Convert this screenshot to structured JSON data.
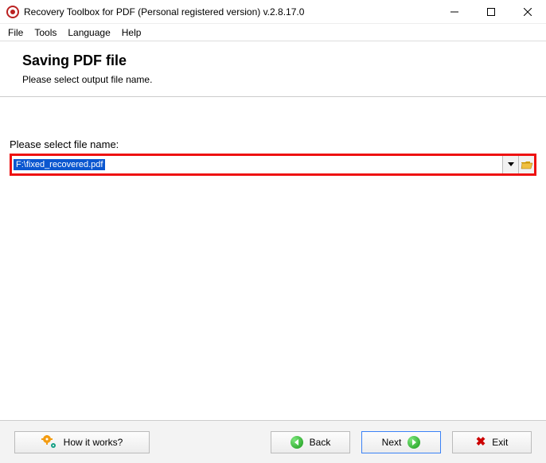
{
  "window": {
    "title": "Recovery Toolbox for PDF (Personal registered version) v.2.8.17.0"
  },
  "menu": {
    "file": "File",
    "tools": "Tools",
    "language": "Language",
    "help": "Help"
  },
  "header": {
    "title": "Saving PDF file",
    "subtitle": "Please select output file name."
  },
  "content": {
    "label": "Please select file name:",
    "file_value": "F:\\fixed_recovered.pdf"
  },
  "footer": {
    "how": "How it works?",
    "back": "Back",
    "next": "Next",
    "exit": "Exit"
  }
}
